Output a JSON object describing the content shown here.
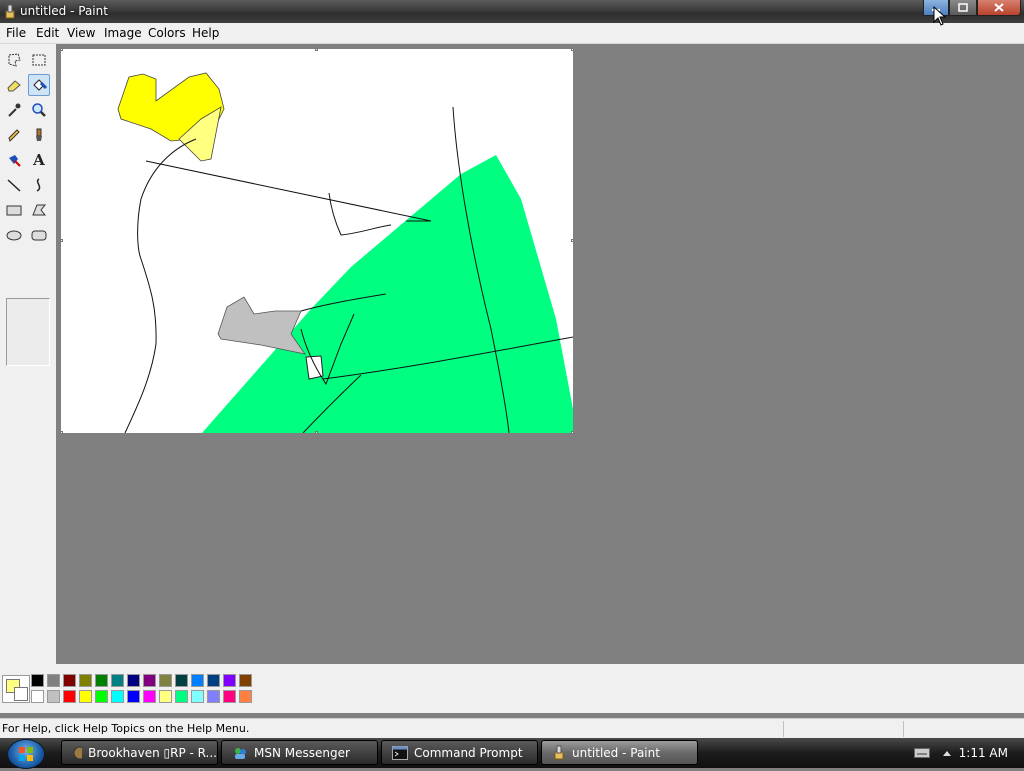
{
  "window": {
    "title": "untitled - Paint"
  },
  "menu": [
    "File",
    "Edit",
    "View",
    "Image",
    "Colors",
    "Help"
  ],
  "tools": [
    {
      "name": "free-form-select-icon",
      "selected": false
    },
    {
      "name": "select-icon",
      "selected": false
    },
    {
      "name": "eraser-icon",
      "selected": false
    },
    {
      "name": "fill-with-color-icon",
      "selected": true
    },
    {
      "name": "pick-color-icon",
      "selected": false
    },
    {
      "name": "magnifier-icon",
      "selected": false
    },
    {
      "name": "pencil-icon",
      "selected": false
    },
    {
      "name": "brush-icon",
      "selected": false
    },
    {
      "name": "airbrush-icon",
      "selected": false
    },
    {
      "name": "text-icon",
      "selected": false
    },
    {
      "name": "line-icon",
      "selected": false
    },
    {
      "name": "curve-icon",
      "selected": false
    },
    {
      "name": "rectangle-icon",
      "selected": false
    },
    {
      "name": "polygon-icon",
      "selected": false
    },
    {
      "name": "ellipse-icon",
      "selected": false
    },
    {
      "name": "rounded-rectangle-icon",
      "selected": false
    }
  ],
  "text_tool_glyph": "A",
  "colors": {
    "foreground": "#ffff80",
    "background": "#ffffff",
    "palette_top": [
      "#000000",
      "#808080",
      "#800000",
      "#808000",
      "#008000",
      "#008080",
      "#000080",
      "#800080",
      "#808040",
      "#004040",
      "#0080ff",
      "#004080",
      "#8000ff",
      "#804000"
    ],
    "palette_bottom": [
      "#ffffff",
      "#c0c0c0",
      "#ff0000",
      "#ffff00",
      "#00ff00",
      "#00ffff",
      "#0000ff",
      "#ff00ff",
      "#ffff80",
      "#00ff80",
      "#80ffff",
      "#8080ff",
      "#ff0080",
      "#ff8040"
    ]
  },
  "status": {
    "text": "For Help, click Help Topics on the Help Menu."
  },
  "taskbar": {
    "items": [
      {
        "label": "Brookhaven ▯RP - R...",
        "active": false
      },
      {
        "label": "MSN Messenger",
        "active": false
      },
      {
        "label": "Command Prompt",
        "active": false
      },
      {
        "label": "untitled - Paint",
        "active": true
      }
    ],
    "clock": "1:11 AM"
  }
}
